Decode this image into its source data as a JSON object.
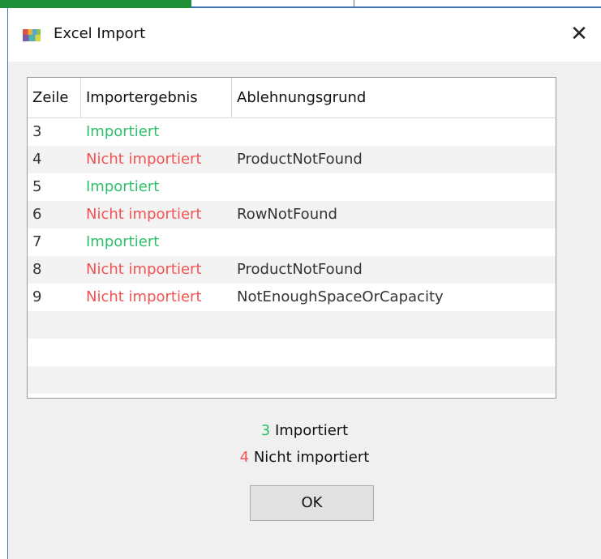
{
  "window": {
    "title": "Excel Import",
    "icon": "excel-import-icon",
    "close_glyph": "✕"
  },
  "table": {
    "columns": [
      "Zeile",
      "Importergebnis",
      "Ablehnungsgrund"
    ],
    "rows": [
      {
        "zeile": "3",
        "ergebnis": "Importiert",
        "grund": "",
        "status": "ok"
      },
      {
        "zeile": "4",
        "ergebnis": "Nicht importiert",
        "grund": "ProductNotFound",
        "status": "error"
      },
      {
        "zeile": "5",
        "ergebnis": "Importiert",
        "grund": "",
        "status": "ok"
      },
      {
        "zeile": "6",
        "ergebnis": "Nicht importiert",
        "grund": "RowNotFound",
        "status": "error"
      },
      {
        "zeile": "7",
        "ergebnis": "Importiert",
        "grund": "",
        "status": "ok"
      },
      {
        "zeile": "8",
        "ergebnis": "Nicht importiert",
        "grund": "ProductNotFound",
        "status": "error"
      },
      {
        "zeile": "9",
        "ergebnis": "Nicht importiert",
        "grund": "NotEnoughSpaceOrCapacity",
        "status": "error"
      }
    ]
  },
  "summary": {
    "imported_count": "3",
    "imported_label": "Importiert",
    "failed_count": "4",
    "failed_label": "Nicht importiert"
  },
  "buttons": {
    "ok_label": "OK"
  },
  "colors": {
    "ok": "#2fbf6a",
    "error": "#f25454",
    "border_accent": "#3a72c6"
  }
}
